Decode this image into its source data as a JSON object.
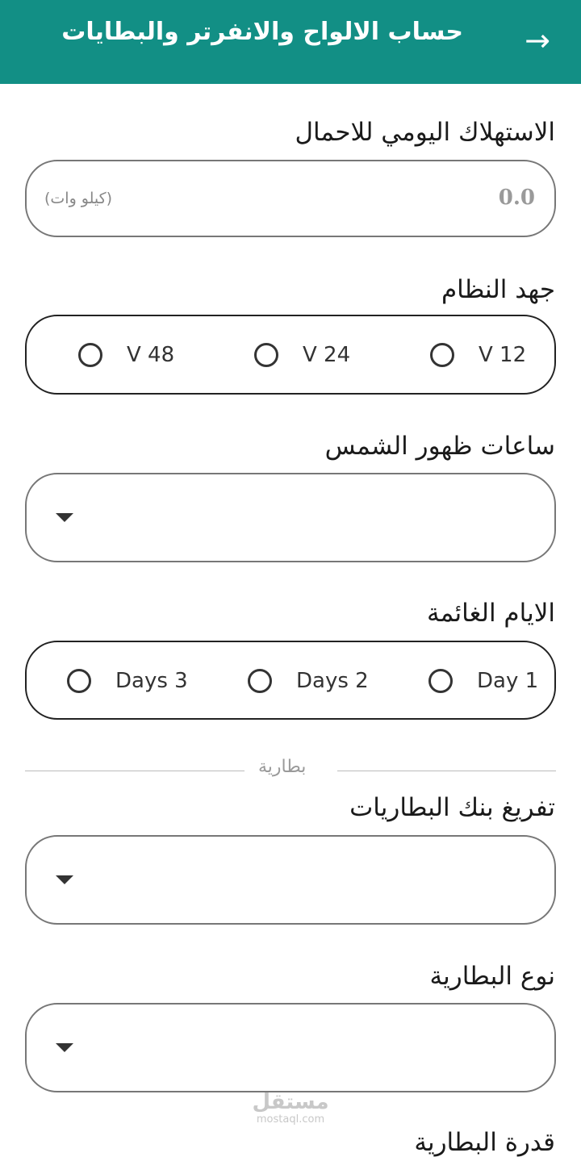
{
  "appbar": {
    "title": "حساب الالواح والانفرتر والبطايات",
    "back_icon": "arrow-right-icon"
  },
  "daily_consumption": {
    "label": "الاستهلاك اليومي للاحمال",
    "value": "0.0",
    "suffix": "(كيلو وات)"
  },
  "system_voltage": {
    "label": "جهد النظام",
    "options": [
      "V 12",
      "V 24",
      "V 48"
    ],
    "selected": null
  },
  "sun_hours": {
    "label": "ساعات ظهور الشمس",
    "value": ""
  },
  "cloudy_days": {
    "label": "الايام الغائمة",
    "options": [
      "Day 1",
      "Days 2",
      "Days 3"
    ],
    "selected": null
  },
  "battery_divider": {
    "label": "بطارية"
  },
  "battery_discharge": {
    "label": "تفريغ بنك البطاريات",
    "value": ""
  },
  "battery_type": {
    "label": "نوع البطارية",
    "value": ""
  },
  "battery_capacity": {
    "label": "قدرة البطارية"
  },
  "watermark": {
    "main": "مستقل",
    "sub": "mostaql.com"
  },
  "colors": {
    "appbar": "#128f85",
    "text": "#1a1a1a",
    "muted": "#9a9a9a"
  }
}
